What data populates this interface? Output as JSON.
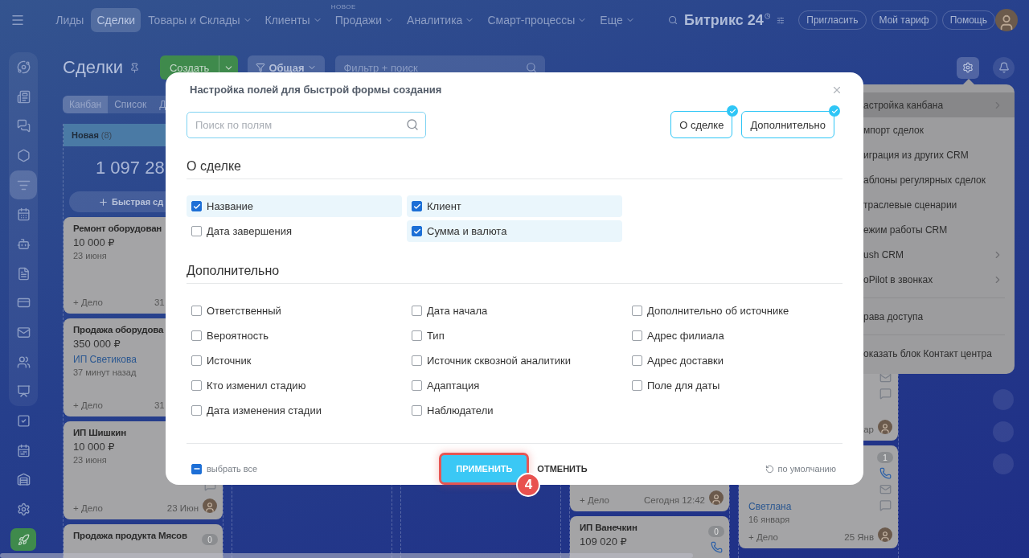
{
  "topbar": {
    "nav": [
      {
        "label": "Лиды",
        "selected": false,
        "dropdown": false
      },
      {
        "label": "Сделки",
        "selected": true,
        "dropdown": false
      },
      {
        "label": "Товары и Склады",
        "selected": false,
        "dropdown": true
      },
      {
        "label": "Клиенты",
        "selected": false,
        "dropdown": true
      },
      {
        "label": "Продажи",
        "selected": false,
        "dropdown": true,
        "badge": "НОВОЕ"
      },
      {
        "label": "Аналитика",
        "selected": false,
        "dropdown": true
      },
      {
        "label": "Смарт-процессы",
        "selected": false,
        "dropdown": true
      },
      {
        "label": "Еще",
        "selected": false,
        "dropdown": true
      }
    ],
    "logo": "Битрикс 24",
    "buttons": [
      "Пригласить",
      "Мой тариф",
      "Помощь"
    ]
  },
  "sidebar": {
    "items": [
      {
        "selected": false
      },
      {
        "selected": false
      },
      {
        "selected": false
      },
      {
        "selected": false
      },
      {
        "selected": true
      },
      {
        "selected": false
      },
      {
        "selected": false
      },
      {
        "selected": false
      },
      {
        "selected": false
      },
      {
        "selected": false
      },
      {
        "selected": false
      },
      {
        "selected": false
      },
      {
        "selected": false
      },
      {
        "selected": false
      },
      {
        "selected": false
      },
      {
        "selected": false
      }
    ]
  },
  "page": {
    "title": "Сделки",
    "create_button": "Создать",
    "filter_preset": "Общая",
    "filter_placeholder": "Фильтр + поиск",
    "views": [
      {
        "label": "Канбан",
        "selected": true
      },
      {
        "label": "Список",
        "selected": false
      },
      {
        "label": "Д",
        "selected": false
      }
    ]
  },
  "kanban": {
    "columns": [
      {
        "kind": "stage",
        "title": "Новая",
        "count": "(8)",
        "total": "1 097 28",
        "quick_add": "Быстрая сд",
        "cards": [
          {
            "title": "Ремонт оборудован",
            "amount": "10 000 ₽",
            "date": "23 июня",
            "action": "+ Дело",
            "time": "31"
          },
          {
            "title": "Продажа оборудова",
            "amount": "350 000 ₽",
            "client": "ИП Светикова",
            "date": "37 минут назад",
            "action": "+ Дело",
            "time": "31"
          },
          {
            "title": "ИП Шишкин",
            "amount": "10 000 ₽",
            "date": "23 июня",
            "action": "+ Дело",
            "time": "23 Июн"
          },
          {
            "title": "Продажа продукта Мясов",
            "badge": "0"
          }
        ]
      },
      {
        "kind": "empty"
      },
      {
        "kind": "empty"
      },
      {
        "kind": "stage",
        "cards": [
          {
            "action": "+ Дело",
            "time": "Сегодня 12:42"
          },
          {
            "title": "ИП Ванечкин",
            "amount": "109 020 ₽",
            "badge": "0"
          }
        ]
      },
      {
        "kind": "stage",
        "cards": [
          {
            "time": "ар"
          },
          {
            "badge": "1",
            "client": "Светлана",
            "date": "16 января",
            "action": "+ Дело",
            "time": "25 Янв"
          }
        ]
      }
    ]
  },
  "settings_menu": {
    "groups": [
      [
        {
          "label": "астройка канбана",
          "submenu": true,
          "hovered": true
        },
        {
          "label": "мпорт сделок",
          "submenu": false,
          "hovered": false
        },
        {
          "label": "играция из других CRM",
          "submenu": false,
          "hovered": false
        },
        {
          "label": "аблоны регулярных сделок",
          "submenu": false,
          "hovered": false
        },
        {
          "label": "траслевые сценарии",
          "submenu": false,
          "hovered": false
        },
        {
          "label": "ежим работы CRM",
          "submenu": false,
          "hovered": false
        },
        {
          "label": "ush CRM",
          "submenu": true,
          "hovered": false
        },
        {
          "label": "oPilot в звонках",
          "submenu": true,
          "hovered": false
        }
      ],
      [
        {
          "label": "рава доступа",
          "submenu": false,
          "hovered": false
        }
      ],
      [
        {
          "label": "оказать блок Контакт центра",
          "submenu": false,
          "hovered": false
        }
      ]
    ]
  },
  "dialog": {
    "title": "Настройка полей для быстрой формы создания",
    "search_placeholder": "Поиск по полям",
    "section_chips": [
      {
        "label": "О сделке",
        "selected": true
      },
      {
        "label": "Дополнительно",
        "selected": true
      }
    ],
    "sections": [
      {
        "title": "О сделке",
        "columns": [
          [
            {
              "label": "Название",
              "checked": true
            },
            {
              "label": "Дата завершения",
              "checked": false
            }
          ],
          [
            {
              "label": "Клиент",
              "checked": true
            },
            {
              "label": "Сумма и валюта",
              "checked": true
            }
          ]
        ]
      },
      {
        "title": "Дополнительно",
        "columns": [
          [
            {
              "label": "Ответственный",
              "checked": false
            },
            {
              "label": "Вероятность",
              "checked": false
            },
            {
              "label": "Источник",
              "checked": false
            },
            {
              "label": "Кто изменил стадию",
              "checked": false
            },
            {
              "label": "Дата изменения стадии",
              "checked": false
            }
          ],
          [
            {
              "label": "Дата начала",
              "checked": false
            },
            {
              "label": "Тип",
              "checked": false
            },
            {
              "label": "Источник сквозной аналитики",
              "checked": false
            },
            {
              "label": "Адаптация",
              "checked": false
            },
            {
              "label": "Наблюдатели",
              "checked": false
            }
          ],
          [
            {
              "label": "Дополнительно об источнике",
              "checked": false
            },
            {
              "label": "Адрес филиала",
              "checked": false
            },
            {
              "label": "Адрес доставки",
              "checked": false
            },
            {
              "label": "Поле для даты",
              "checked": false
            }
          ]
        ]
      }
    ],
    "select_all": {
      "label": "выбрать все",
      "indeterminate": true
    },
    "apply": {
      "label": "ПРИМЕНИТЬ",
      "highlighted": true
    },
    "cancel": "ОТМЕНИТЬ",
    "reset": "по умолчанию",
    "step_badge": "4"
  }
}
